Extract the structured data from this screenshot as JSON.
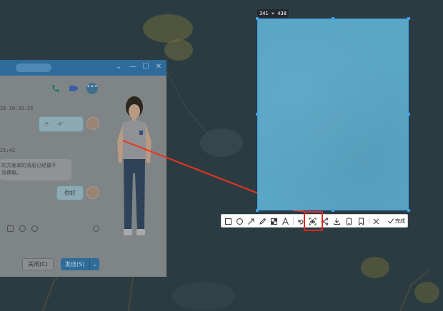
{
  "screenshot_tool": {
    "size_label": "341 × 438",
    "done_label": "完成",
    "tools": [
      {
        "name": "rectangle-icon"
      },
      {
        "name": "ellipse-icon"
      },
      {
        "name": "arrow-icon"
      },
      {
        "name": "pencil-icon"
      },
      {
        "name": "mosaic-icon"
      },
      {
        "name": "text-icon"
      },
      {
        "name": "undo-icon"
      },
      {
        "name": "ocr-scan-icon"
      },
      {
        "name": "share-icon"
      },
      {
        "name": "download-icon"
      },
      {
        "name": "phone-icon"
      },
      {
        "name": "pin-icon"
      },
      {
        "name": "close-icon"
      },
      {
        "name": "check-icon"
      }
    ]
  },
  "chat": {
    "timestamp_1": "26 10:39:26",
    "timestamp_2": "21:42",
    "incoming_message": "的方发来的消息已经被不\n法获取。",
    "outgoing_message": "你好",
    "voice_duration": "4\"",
    "close_button": "关闭(C)",
    "send_button": "发送(S)"
  },
  "colors": {
    "selection_border": "#3ea0e8",
    "highlight": "#e8261f",
    "annotation_arrow": "#f0321e"
  }
}
